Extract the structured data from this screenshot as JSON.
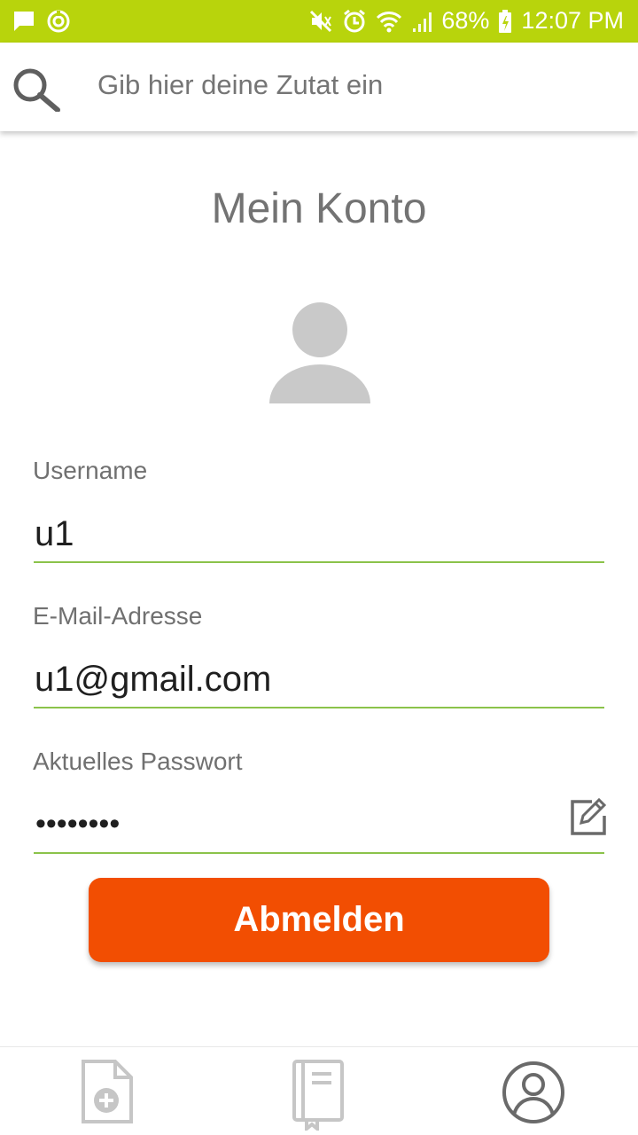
{
  "status_bar": {
    "battery": "68%",
    "time": "12:07 PM",
    "background_color": "#b8d40c",
    "icons": [
      "message-icon",
      "sync-icon",
      "mute-icon",
      "alarm-icon",
      "wifi-icon",
      "signal-icon",
      "battery-icon"
    ]
  },
  "search": {
    "placeholder": "Gib hier deine Zutat ein"
  },
  "page": {
    "title": "Mein Konto"
  },
  "form": {
    "username_label": "Username",
    "username_value": "u1",
    "email_label": "E-Mail-Adresse",
    "email_value": "u1@gmail.com",
    "password_label": "Aktuelles Passwort",
    "password_value": "••••••••",
    "underline_color": "#8bc34a"
  },
  "logout": {
    "label": "Abmelden",
    "color": "#f24e02"
  },
  "bottom_nav": {
    "items": [
      {
        "icon": "add-document-icon",
        "active": false
      },
      {
        "icon": "recipe-book-icon",
        "active": false
      },
      {
        "icon": "account-icon",
        "active": true
      }
    ]
  }
}
